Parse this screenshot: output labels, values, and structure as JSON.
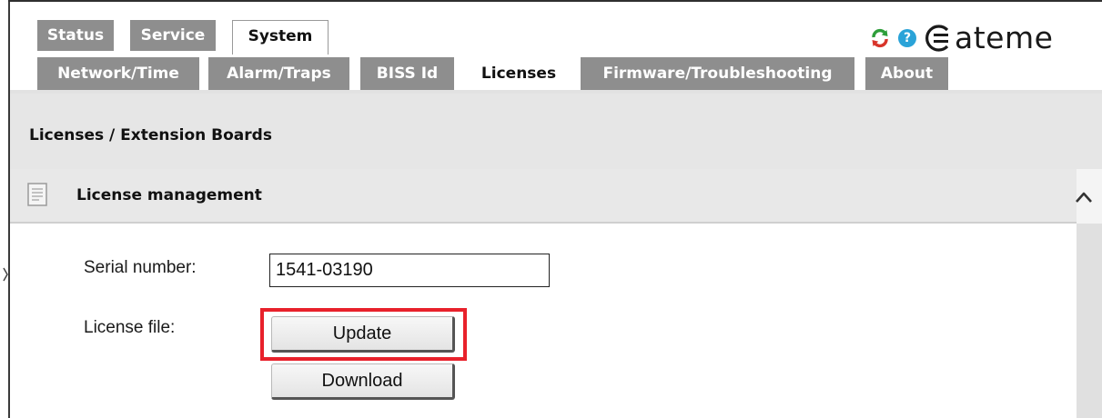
{
  "tabs_row1": [
    {
      "label": "Status",
      "active": false
    },
    {
      "label": "Service",
      "active": false
    },
    {
      "label": "System",
      "active": true
    }
  ],
  "tabs_row2": [
    {
      "label": "Network/Time",
      "active": false
    },
    {
      "label": "Alarm/Traps",
      "active": false
    },
    {
      "label": "BISS Id",
      "active": false
    },
    {
      "label": "Licenses",
      "active": true
    },
    {
      "label": "Firmware/Troubleshooting",
      "active": false
    },
    {
      "label": "About",
      "active": false
    }
  ],
  "header": {
    "brand": "ateme",
    "icons": [
      "refresh-icon",
      "help-icon",
      "ateme-logo"
    ]
  },
  "page": {
    "title": "Licenses / Extension Boards"
  },
  "panel": {
    "title": "License management",
    "icon": "document-icon",
    "collapse_icon": "chevron-up-icon"
  },
  "form": {
    "serial_label": "Serial number:",
    "serial_value": "1541-03190",
    "license_label": "License file:",
    "update_label": "Update",
    "download_label": "Download"
  },
  "colors": {
    "tab_inactive": "#8e8e8e",
    "tab_active": "#ffffff",
    "title_bar": "#e6e6e6",
    "panel_header": "#e8e8e8",
    "highlight": "#e8212b",
    "help_icon": "#2aa3d8"
  }
}
